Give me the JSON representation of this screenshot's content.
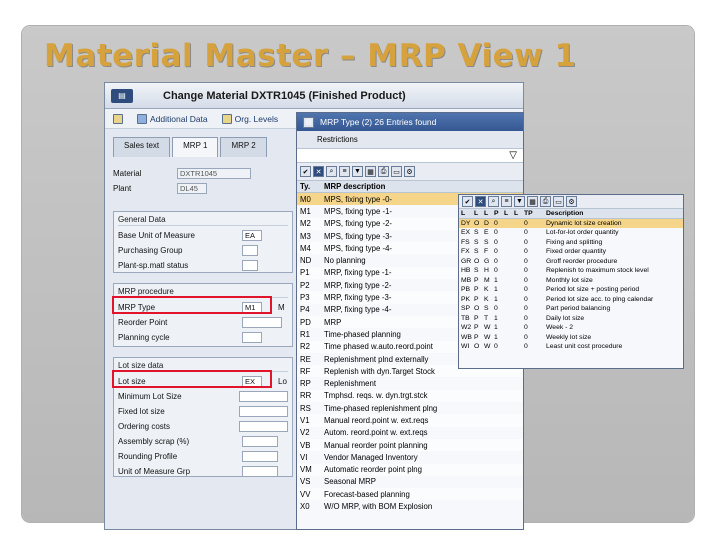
{
  "slide": {
    "title": "Material Master – MRP View 1"
  },
  "sap": {
    "window_button": "▤",
    "title": "Change Material DXTR1045 (Finished Product)",
    "toolbar": {
      "additional_data": "Additional Data",
      "org_levels": "Org. Levels"
    },
    "tabs": [
      "Sales text",
      "MRP 1",
      "MRP 2"
    ],
    "fields": {
      "material_label": "Material",
      "material_value": "DXTR1045",
      "plant_label": "Plant",
      "plant_value": "DL45"
    },
    "general_data": {
      "title": "General Data",
      "base_uom_label": "Base Unit of Measure",
      "base_uom_value": "EA",
      "purchasing_group_label": "Purchasing Group",
      "plant_sp_status_label": "Plant-sp.matl status"
    },
    "mrp_procedure": {
      "title": "MRP procedure",
      "mrp_type_label": "MRP Type",
      "mrp_type_value": "M1",
      "reorder_point_label": "Reorder Point",
      "planning_cycle_label": "Planning cycle",
      "side_label": "M"
    },
    "lot_size_data": {
      "title": "Lot size data",
      "lot_size_label": "Lot size",
      "lot_size_value": "EX",
      "side_label": "Lo",
      "min_lot_label": "Minimum Lot Size",
      "fixed_lot_label": "Fixed lot size",
      "ordering_costs_label": "Ordering costs",
      "assembly_scrap_label": "Assembly scrap (%)",
      "rounding_profile_label": "Rounding Profile",
      "uom_grp_label": "Unit of Measure Grp"
    }
  },
  "mrp_popup": {
    "title": "MRP Type (2)  26 Entries found",
    "restrictions": "Restrictions",
    "col_type": "Ty.",
    "col_desc": "MRP description",
    "rows": [
      [
        "M0",
        "MPS, fixing type -0-"
      ],
      [
        "M1",
        "MPS, fixing type -1-"
      ],
      [
        "M2",
        "MPS, fixing type -2-"
      ],
      [
        "M3",
        "MPS, fixing type -3-"
      ],
      [
        "M4",
        "MPS, fixing type -4-"
      ],
      [
        "ND",
        "No planning"
      ],
      [
        "P1",
        "MRP, fixing type -1-"
      ],
      [
        "P2",
        "MRP, fixing type -2-"
      ],
      [
        "P3",
        "MRP, fixing type -3-"
      ],
      [
        "P4",
        "MRP, fixing type -4-"
      ],
      [
        "PD",
        "MRP"
      ],
      [
        "R1",
        "Time-phased planning"
      ],
      [
        "R2",
        "Time phased w.auto.reord.point"
      ],
      [
        "RE",
        "Replenishment plnd externally"
      ],
      [
        "RF",
        "Replenish with dyn.Target Stock"
      ],
      [
        "RP",
        "Replenishment"
      ],
      [
        "RR",
        "Tmphsd. reqs. w. dyn.trgt.stck"
      ],
      [
        "RS",
        "Time-phased replenishment plng"
      ],
      [
        "V1",
        "Manual reord.point w. ext.reqs"
      ],
      [
        "V2",
        "Autom. reord.point w. ext.reqs"
      ],
      [
        "VB",
        "Manual reorder point planning"
      ],
      [
        "VI",
        "Vendor Managed Inventory"
      ],
      [
        "VM",
        "Automatic reorder point plng"
      ],
      [
        "VS",
        "Seasonal MRP"
      ],
      [
        "VV",
        "Forecast-based planning"
      ],
      [
        "X0",
        "W/O MRP, with BOM Explosion"
      ]
    ]
  },
  "lot_popup": {
    "headers": [
      "L",
      "L",
      "L",
      "P",
      "L",
      "L",
      "TP",
      "Description"
    ],
    "rows": [
      [
        "DY",
        "O",
        "D",
        "0",
        "0",
        "Dynamic lot size creation"
      ],
      [
        "EX",
        "S",
        "E",
        "0",
        "0",
        "Lot-for-lot order quantity"
      ],
      [
        "FS",
        "S",
        "S",
        "0",
        "0",
        "Fixing and splitting"
      ],
      [
        "FX",
        "S",
        "F",
        "0",
        "0",
        "Fixed order quantity"
      ],
      [
        "GR",
        "O",
        "G",
        "0",
        "0",
        "Groff reorder procedure"
      ],
      [
        "HB",
        "S",
        "H",
        "0",
        "0",
        "Replenish to maximum stock level"
      ],
      [
        "MB",
        "P",
        "M",
        "1",
        "0",
        "Monthly lot size"
      ],
      [
        "PB",
        "P",
        "K",
        "1",
        "0",
        "Period lot size + posting period"
      ],
      [
        "PK",
        "P",
        "K",
        "1",
        "0",
        "Period lot size acc. to plng calendar"
      ],
      [
        "SP",
        "O",
        "S",
        "0",
        "0",
        "Part period balancing"
      ],
      [
        "TB",
        "P",
        "T",
        "1",
        "0",
        "Daily lot size"
      ],
      [
        "W2",
        "P",
        "W",
        "1",
        "0",
        "Week - 2"
      ],
      [
        "WB",
        "P",
        "W",
        "1",
        "0",
        "Weekly lot size"
      ],
      [
        "WI",
        "O",
        "W",
        "0",
        "0",
        "Least unit cost procedure"
      ]
    ]
  },
  "colors": {
    "title_gold": "#d6a23e",
    "highlight": "#e0142a",
    "selected_row": "#f5d58a",
    "popup_header": "#365892"
  }
}
